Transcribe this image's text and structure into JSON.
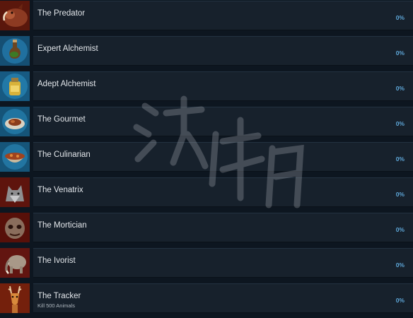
{
  "achievements": [
    {
      "title": "The Predator",
      "description": "",
      "progress": "0%",
      "icon": "boar-icon",
      "bg": "#6b1d0f"
    },
    {
      "title": "Expert Alchemist",
      "description": "",
      "progress": "0%",
      "icon": "potion-flask-icon",
      "bg": "#1b5f86"
    },
    {
      "title": "Adept Alchemist",
      "description": "",
      "progress": "0%",
      "icon": "potion-jar-icon",
      "bg": "#1e6a92"
    },
    {
      "title": "The Gourmet",
      "description": "",
      "progress": "0%",
      "icon": "food-plate-icon",
      "bg": "#1a6490"
    },
    {
      "title": "The Culinarian",
      "description": "",
      "progress": "0%",
      "icon": "stew-bowl-icon",
      "bg": "#1b6690"
    },
    {
      "title": "The Venatrix",
      "description": "",
      "progress": "0%",
      "icon": "wolf-icon",
      "bg": "#7a1a12"
    },
    {
      "title": "The Mortician",
      "description": "",
      "progress": "0%",
      "icon": "decayed-head-icon",
      "bg": "#701912"
    },
    {
      "title": "The Ivorist",
      "description": "",
      "progress": "0%",
      "icon": "mammoth-icon",
      "bg": "#7a1c14"
    },
    {
      "title": "The Tracker",
      "description": "Kill 500 Animals",
      "progress": "0%",
      "icon": "deer-icon",
      "bg": "#8a2a10"
    }
  ]
}
